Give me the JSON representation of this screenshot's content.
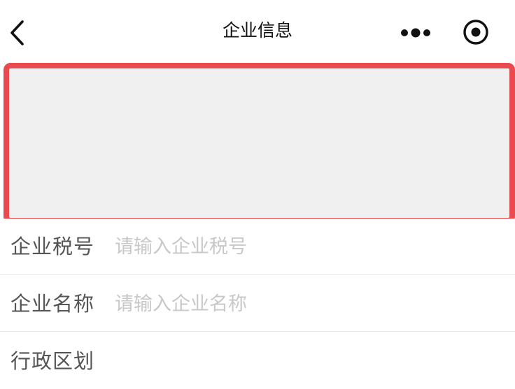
{
  "navbar": {
    "title": "企业信息",
    "back_icon": "chevron-left-icon",
    "more_icon": "more-dots-icon",
    "close_icon": "target-close-icon"
  },
  "banner": {
    "highlight_color": "#e84a50",
    "fill_color": "#f0f0f0"
  },
  "form": {
    "rows": [
      {
        "label": "企业税号",
        "placeholder": "请输入企业税号",
        "value": ""
      },
      {
        "label": "企业名称",
        "placeholder": "请输入企业名称",
        "value": ""
      },
      {
        "label": "行政区划"
      }
    ]
  }
}
